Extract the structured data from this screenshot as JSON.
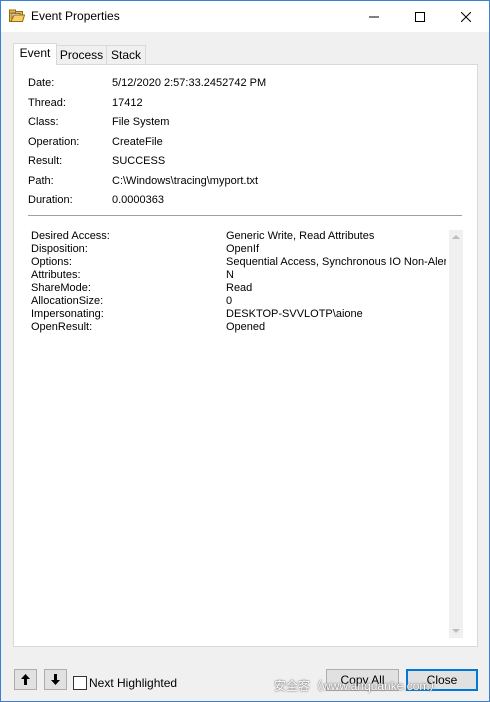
{
  "window": {
    "title": "Event Properties",
    "controls": [
      "minimize",
      "maximize",
      "close"
    ]
  },
  "tabs": [
    {
      "label": "Event",
      "active": true
    },
    {
      "label": "Process",
      "active": false
    },
    {
      "label": "Stack",
      "active": false
    }
  ],
  "event": [
    {
      "key": "Date:",
      "value": "5/12/2020 2:57:33.2452742 PM"
    },
    {
      "key": "Thread:",
      "value": "17412"
    },
    {
      "key": "Class:",
      "value": "File System"
    },
    {
      "key": "Operation:",
      "value": "CreateFile"
    },
    {
      "key": "Result:",
      "value": "SUCCESS"
    },
    {
      "key": "Path:",
      "value": "C:\\Windows\\tracing\\myport.txt"
    },
    {
      "key": "Duration:",
      "value": "0.0000363"
    }
  ],
  "details": [
    {
      "key": "Desired Access:",
      "value": "Generic Write, Read Attributes"
    },
    {
      "key": "Disposition:",
      "value": "OpenIf"
    },
    {
      "key": "Options:",
      "value": "Sequential Access, Synchronous IO Non-Alert,"
    },
    {
      "key": "Attributes:",
      "value": "N"
    },
    {
      "key": "ShareMode:",
      "value": "Read"
    },
    {
      "key": "AllocationSize:",
      "value": "0"
    },
    {
      "key": "Impersonating:",
      "value": "DESKTOP-SVVLOTP\\aione"
    },
    {
      "key": "OpenResult:",
      "value": "Opened"
    }
  ],
  "footer": {
    "up_icon": "arrow-up-icon",
    "down_icon": "arrow-down-icon",
    "next_highlighted_label": "Next Highlighted",
    "next_highlighted_checked": false,
    "copy_all_label": "Copy All",
    "close_label": "Close",
    "watermark": "安全客（www.anquanke.com）"
  },
  "colors": {
    "focus_border": "#0078d7",
    "window_border": "#3b7fd0"
  }
}
